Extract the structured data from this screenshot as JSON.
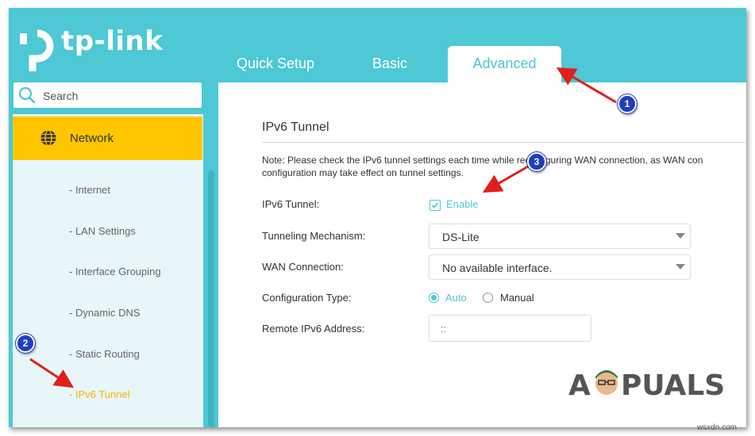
{
  "brand": {
    "name": "tp-link",
    "color": "#4dc8d4"
  },
  "tabs": [
    {
      "label": "Quick Setup"
    },
    {
      "label": "Basic"
    },
    {
      "label": "Advanced",
      "active": true
    }
  ],
  "sidebar": {
    "search_placeholder": "Search",
    "section": {
      "label": "Network",
      "icon": "globe-icon",
      "color": "#ffc600"
    },
    "items": [
      {
        "label": "- Internet"
      },
      {
        "label": "- LAN Settings"
      },
      {
        "label": "- Interface Grouping"
      },
      {
        "label": "- Dynamic DNS"
      },
      {
        "label": "- Static Routing"
      },
      {
        "label": "- IPv6 Tunnel",
        "active": true
      }
    ]
  },
  "main": {
    "title": "IPv6 Tunnel",
    "note_line1": "Note: Please check the IPv6 tunnel settings each time while reconfiguring WAN connection, as WAN con",
    "note_line2": "configuration may take effect on tunnel settings.",
    "fields": {
      "tunnel_label": "IPv6 Tunnel:",
      "enable_label": "Enable",
      "enable_checked": true,
      "mechanism_label": "Tunneling Mechanism:",
      "mechanism_value": "DS-Lite",
      "wan_label": "WAN Connection:",
      "wan_value": "No available interface.",
      "config_label": "Configuration Type:",
      "config_auto": "Auto",
      "config_manual": "Manual",
      "config_selected": "Auto",
      "remote_label": "Remote IPv6 Address:",
      "remote_placeholder": "::"
    }
  },
  "callouts": {
    "one": "1",
    "two": "2",
    "three": "3"
  },
  "watermark": {
    "text_a": "A",
    "text_b": "PUALS"
  },
  "site": "wsxdn.com"
}
